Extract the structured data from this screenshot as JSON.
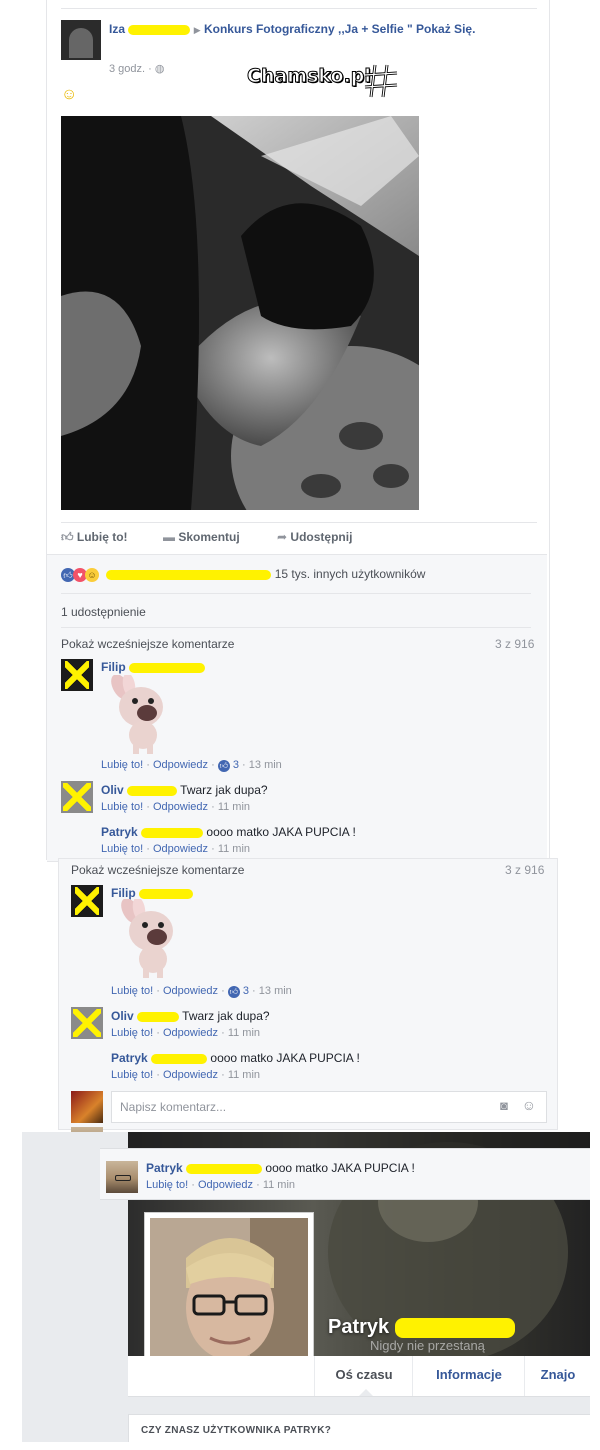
{
  "post": {
    "author_first": "Iza",
    "group": "Konkurs Fotograficzny ,,Ja + Selfie \" Pokaż Się.",
    "time": "3 godz.",
    "globe_icon": "globe-icon",
    "emoji": "☺",
    "watermark": "Chamsko.pl",
    "actions": {
      "like": "Lubię to!",
      "comment": "Skomentuj",
      "share": "Udostępnij"
    },
    "reactions_text": "15 tys. innych użytkowników",
    "shares": "1 udostępnienie",
    "prev_comments": "Pokaż wcześniejsze komentarze",
    "count": "3 z 916"
  },
  "comments": [
    {
      "author": "Filip",
      "text": "",
      "like": "Lubię to!",
      "reply": "Odpowiedz",
      "likes": "3",
      "time": "13 min"
    },
    {
      "author": "Oliv",
      "text": "Twarz jak dupa?",
      "like": "Lubię to!",
      "reply": "Odpowiedz",
      "time": "11 min"
    },
    {
      "author": "Patryk",
      "text": "oooo matko JAKA PUPCIA !",
      "like": "Lubię to!",
      "reply": "Odpowiedz",
      "time": "11 min"
    }
  ],
  "composer": {
    "placeholder": "Napisz komentarz..."
  },
  "profile": {
    "name": "Patryk",
    "cover_text": "Nigdy nie przestaną",
    "tabs": [
      "Oś czasu",
      "Informacje",
      "Znajo"
    ],
    "suggest": "CZY ZNASZ UŻYTKOWNIKA PATRYK?"
  },
  "colors": {
    "link": "#365899",
    "meta": "#90949c",
    "redaction": "#fff200",
    "panel": "#f6f7f9"
  }
}
